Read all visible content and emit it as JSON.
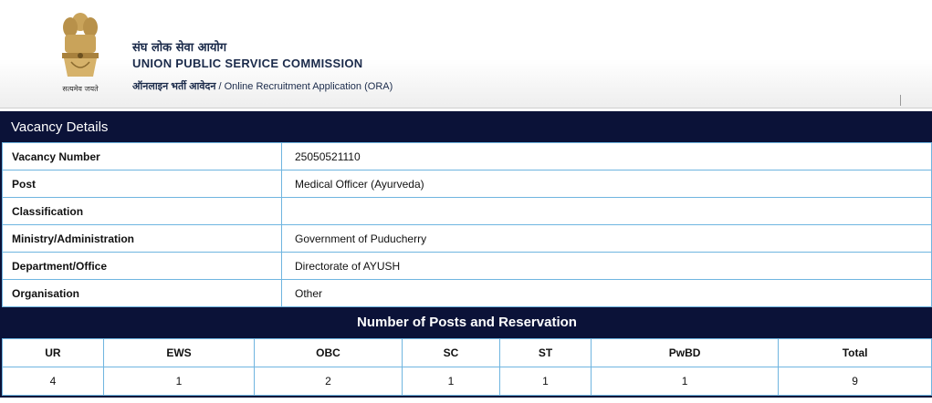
{
  "header": {
    "org_hindi": "संघ लोक सेवा आयोग",
    "org_english": "UNION PUBLIC SERVICE COMMISSION",
    "sub_hindi": "ऑनलाइन भर्ती आवेदन",
    "sub_separator": " / ",
    "sub_english": "Online Recruitment Application (ORA)",
    "motto": "सत्यमेव जयते",
    "emblem_icon": "national-emblem-icon"
  },
  "panel": {
    "title": "Vacancy Details",
    "rows": [
      {
        "label": "Vacancy Number",
        "value": "25050521110"
      },
      {
        "label": "Post",
        "value": "Medical Officer (Ayurveda)"
      },
      {
        "label": "Classification",
        "value": ""
      },
      {
        "label": "Ministry/Administration",
        "value": "Government of Puducherry"
      },
      {
        "label": "Department/Office",
        "value": "Directorate of AYUSH"
      },
      {
        "label": "Organisation",
        "value": "Other"
      }
    ]
  },
  "posts": {
    "title": "Number of Posts and Reservation",
    "headers": [
      "UR",
      "EWS",
      "OBC",
      "SC",
      "ST",
      "PwBD",
      "Total"
    ],
    "values": [
      "4",
      "1",
      "2",
      "1",
      "1",
      "1",
      "9"
    ]
  },
  "colors": {
    "navy": "#0b1238",
    "grid_border": "#6fb5e0",
    "org_text": "#1a2a4a"
  }
}
